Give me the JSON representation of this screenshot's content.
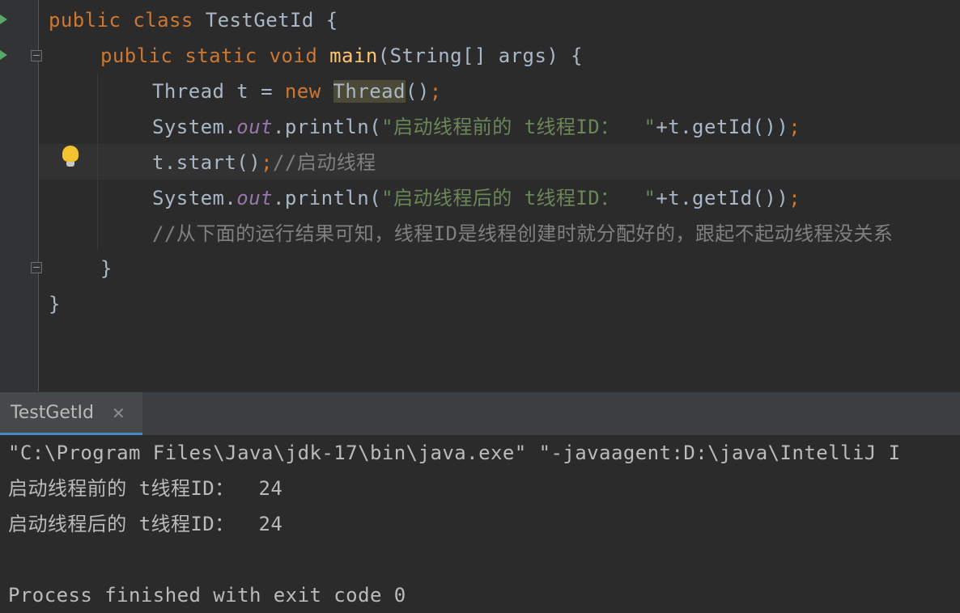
{
  "editor": {
    "line1": {
      "kw1": "public",
      "kw2": "class",
      "name": "TestGetId",
      "brace": " {"
    },
    "line2": {
      "kw1": "public",
      "kw2": "static",
      "kw3": "void",
      "fn": "main",
      "rest": "(String[] args) {"
    },
    "line3": {
      "a": "Thread t = ",
      "kw": "new",
      "hl": "Thread",
      "b": "()",
      "semi": ";"
    },
    "line4": {
      "a": "System.",
      "field": "out",
      "b": ".println(",
      "str": "\"启动线程前的 t线程ID：  \"",
      "c": "+t.getId())",
      "semi": ";"
    },
    "line5": {
      "a": "t.start()",
      "semi": ";",
      "cmt": "//启动线程"
    },
    "line6": {
      "a": "System.",
      "field": "out",
      "b": ".println(",
      "str": "\"启动线程后的 t线程ID：  \"",
      "c": "+t.getId())",
      "semi": ";"
    },
    "line7": {
      "cmt": "//从下面的运行结果可知，线程ID是线程创建时就分配好的，跟起不起动线程没关系"
    },
    "line8": {
      "text": "}"
    },
    "line9": {
      "text": "}"
    }
  },
  "run_tab": {
    "label": "TestGetId",
    "close": "✕"
  },
  "console": {
    "lines": [
      "\"C:\\Program Files\\Java\\jdk-17\\bin\\java.exe\" \"-javaagent:D:\\java\\IntelliJ I",
      "启动线程前的 t线程ID：  24",
      "启动线程后的 t线程ID：  24",
      "",
      "Process finished with exit code 0"
    ]
  },
  "colors": {
    "keyword": "#cc7832",
    "function": "#ffc66d",
    "string": "#6a8759",
    "comment": "#808080",
    "field": "#9876aa",
    "text": "#a9b7c6",
    "background": "#2b2b2b"
  },
  "icons": [
    "run-gutter-icon",
    "fold-icon",
    "lightbulb-icon",
    "close-icon"
  ]
}
